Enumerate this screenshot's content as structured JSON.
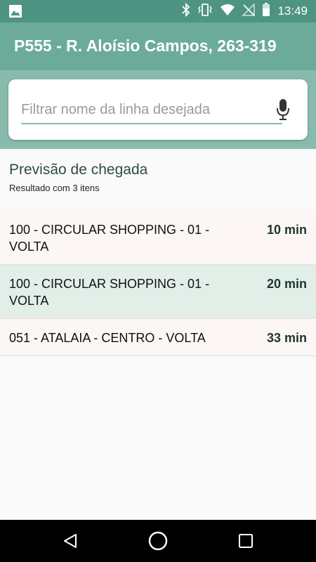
{
  "status_bar": {
    "time": "13:49",
    "icons": [
      "image-icon",
      "bluetooth-icon",
      "vibrate-icon",
      "wifi-icon",
      "no-signal-icon",
      "battery-icon"
    ]
  },
  "app_bar": {
    "title": "P555 - R. Aloísio Campos, 263-319"
  },
  "search": {
    "placeholder": "Filtrar nome da linha desejada",
    "value": "",
    "mic_icon": "microphone-icon"
  },
  "results": {
    "title": "Previsão de chegada",
    "count_text": "Resultado com 3 itens",
    "items": [
      {
        "name": "100 - CIRCULAR SHOPPING - 01 - VOLTA",
        "eta": "10 min"
      },
      {
        "name": "100 - CIRCULAR SHOPPING - 01 - VOLTA",
        "eta": "20 min"
      },
      {
        "name": "051 - ATALAIA - CENTRO - VOLTA",
        "eta": "33 min"
      }
    ]
  },
  "nav_bar": {
    "icons": [
      "back-icon",
      "home-icon",
      "recents-icon"
    ]
  },
  "colors": {
    "status_bar": "#4f9483",
    "app_bar": "#6cab99",
    "search_section": "#88bbad",
    "row_default": "#fcf7f5",
    "row_highlight": "#e2efe9",
    "eta_text": "#1f3530"
  }
}
